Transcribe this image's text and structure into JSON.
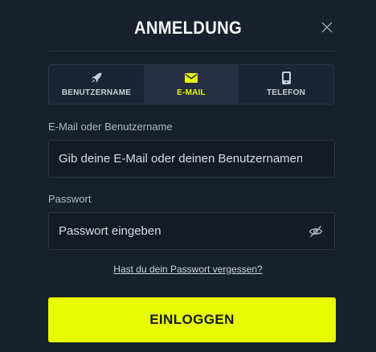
{
  "dialog": {
    "title": "ANMELDUNG",
    "close_icon": "close-icon"
  },
  "tabs": [
    {
      "label": "BENUTZERNAME",
      "icon": "rocket-icon",
      "active": false
    },
    {
      "label": "E-MAIL",
      "icon": "envelope-icon",
      "active": true
    },
    {
      "label": "TELEFON",
      "icon": "phone-icon",
      "active": false
    }
  ],
  "email_field": {
    "label": "E-Mail oder Benutzername",
    "value": "",
    "placeholder": "Gib deine E-Mail oder deinen Benutzernamen ein"
  },
  "password_field": {
    "label": "Passwort",
    "value": "",
    "placeholder": "Passwort eingeben",
    "toggle_icon": "eye-off-icon"
  },
  "forgot_link": "Hast du dein Passwort vergessen?",
  "login_button": "EINLOGGEN",
  "colors": {
    "background": "#18202e",
    "accent": "#e8fc00",
    "input_bg": "#141b27",
    "border": "#2c3546"
  }
}
